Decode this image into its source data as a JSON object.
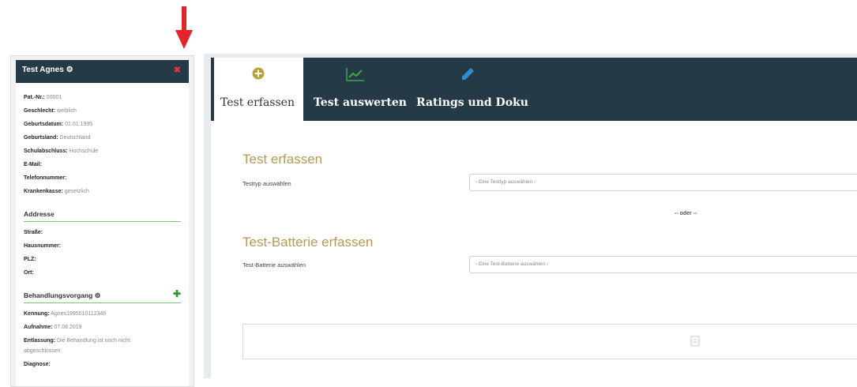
{
  "sidebar": {
    "title": "Test Agnes",
    "patient": [
      {
        "label": "Pat.-Nr.:",
        "value": "00001"
      },
      {
        "label": "Geschlecht:",
        "value": "weiblich"
      },
      {
        "label": "Geburtsdatum:",
        "value": "01.01.1995"
      },
      {
        "label": "Geburtsland:",
        "value": "Deutschland"
      },
      {
        "label": "Schulabschluss:",
        "value": "Hochschule"
      },
      {
        "label": "E-Mail:",
        "value": ""
      },
      {
        "label": "Telefonnummer:",
        "value": ""
      },
      {
        "label": "Krankenkasse:",
        "value": "gesetzlich"
      }
    ],
    "address_title": "Addresse",
    "address": [
      {
        "label": "Straße:",
        "value": ""
      },
      {
        "label": "Hausnummer:",
        "value": ""
      },
      {
        "label": "PLZ:",
        "value": ""
      },
      {
        "label": "Ort:",
        "value": ""
      }
    ],
    "treatment_title": "Behandlungsvorgang",
    "treatment": [
      {
        "label": "Kennung:",
        "value": "Agnes1995010112346"
      },
      {
        "label": "Aufnahme:",
        "value": "07.08.2019"
      },
      {
        "label": "Entlassung:",
        "value": "Die Behandlung ist noch nicht"
      },
      {
        "label": "",
        "value": "abgeschlossen"
      },
      {
        "label": "Diagnose:",
        "value": ""
      }
    ]
  },
  "tabs": [
    {
      "label": "Test erfassen",
      "icon": "plus-circle-icon"
    },
    {
      "label": "Test auswerten",
      "icon": "chart-line-icon"
    },
    {
      "label": "Ratings und Doku",
      "icon": "pencil-icon"
    }
  ],
  "content": {
    "test_heading": "Test erfassen",
    "test_label": "Testtyp auswählen",
    "test_placeholder": "- Eine Testtyp auswählen -",
    "or_text": "-- oder --",
    "battery_heading": "Test-Batterie erfassen",
    "battery_label": "Test-Batterie auswählen",
    "battery_placeholder": "- Eine Test-Batterie auswählen -"
  },
  "colors": {
    "header": "#243a47",
    "heading_gold": "#b59a55",
    "arrow_red": "#e8222b",
    "accent_green": "#2f9a3a"
  }
}
